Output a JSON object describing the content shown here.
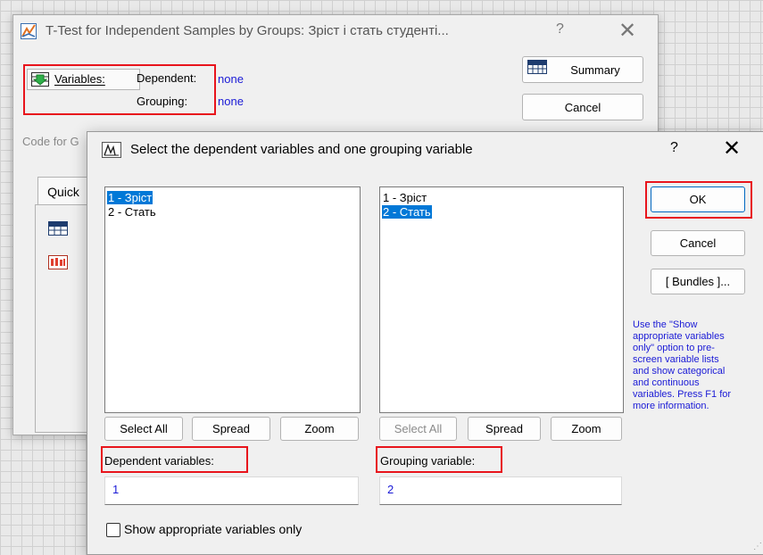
{
  "main_window": {
    "title": "T-Test for Independent Samples by Groups: Зріст і стать студенті...",
    "help": "?",
    "close": "✕",
    "variables_button": "Variables:",
    "dependent_label": "Dependent:",
    "dependent_value": "none",
    "grouping_label": "Grouping:",
    "grouping_value": "none",
    "summary_button": "Summary",
    "cancel_button": "Cancel",
    "code_for_label": "Code for G",
    "tab_quick": "Quick"
  },
  "dialog": {
    "title": "Select the dependent variables and one grouping variable",
    "help": "?",
    "close": "✕",
    "left_list": {
      "items": [
        {
          "label": "1 - Зріст",
          "selected": true
        },
        {
          "label": "2 - Стать",
          "selected": false
        }
      ],
      "buttons": {
        "select_all": "Select All",
        "spread": "Spread",
        "zoom": "Zoom"
      },
      "field_label": "Dependent variables:",
      "field_value": "1"
    },
    "right_list": {
      "items": [
        {
          "label": "1 - Зріст",
          "selected": false
        },
        {
          "label": "2 - Стать",
          "selected": true
        }
      ],
      "buttons": {
        "select_all": "Select All",
        "spread": "Spread",
        "zoom": "Zoom"
      },
      "field_label": "Grouping variable:",
      "field_value": "2"
    },
    "ok_button": "OK",
    "cancel_button": "Cancel",
    "bundles_button": "[ Bundles ]...",
    "hint_text": "Use the \"Show appropriate variables only\" option to pre-screen variable lists and show categorical and continuous variables. Press F1 for more information.",
    "checkbox_label": "Show appropriate variables only",
    "checkbox_checked": false
  },
  "colors": {
    "highlight_red": "#e8141c",
    "selection_blue": "#0078d7",
    "value_blue": "#1a1ad6"
  }
}
